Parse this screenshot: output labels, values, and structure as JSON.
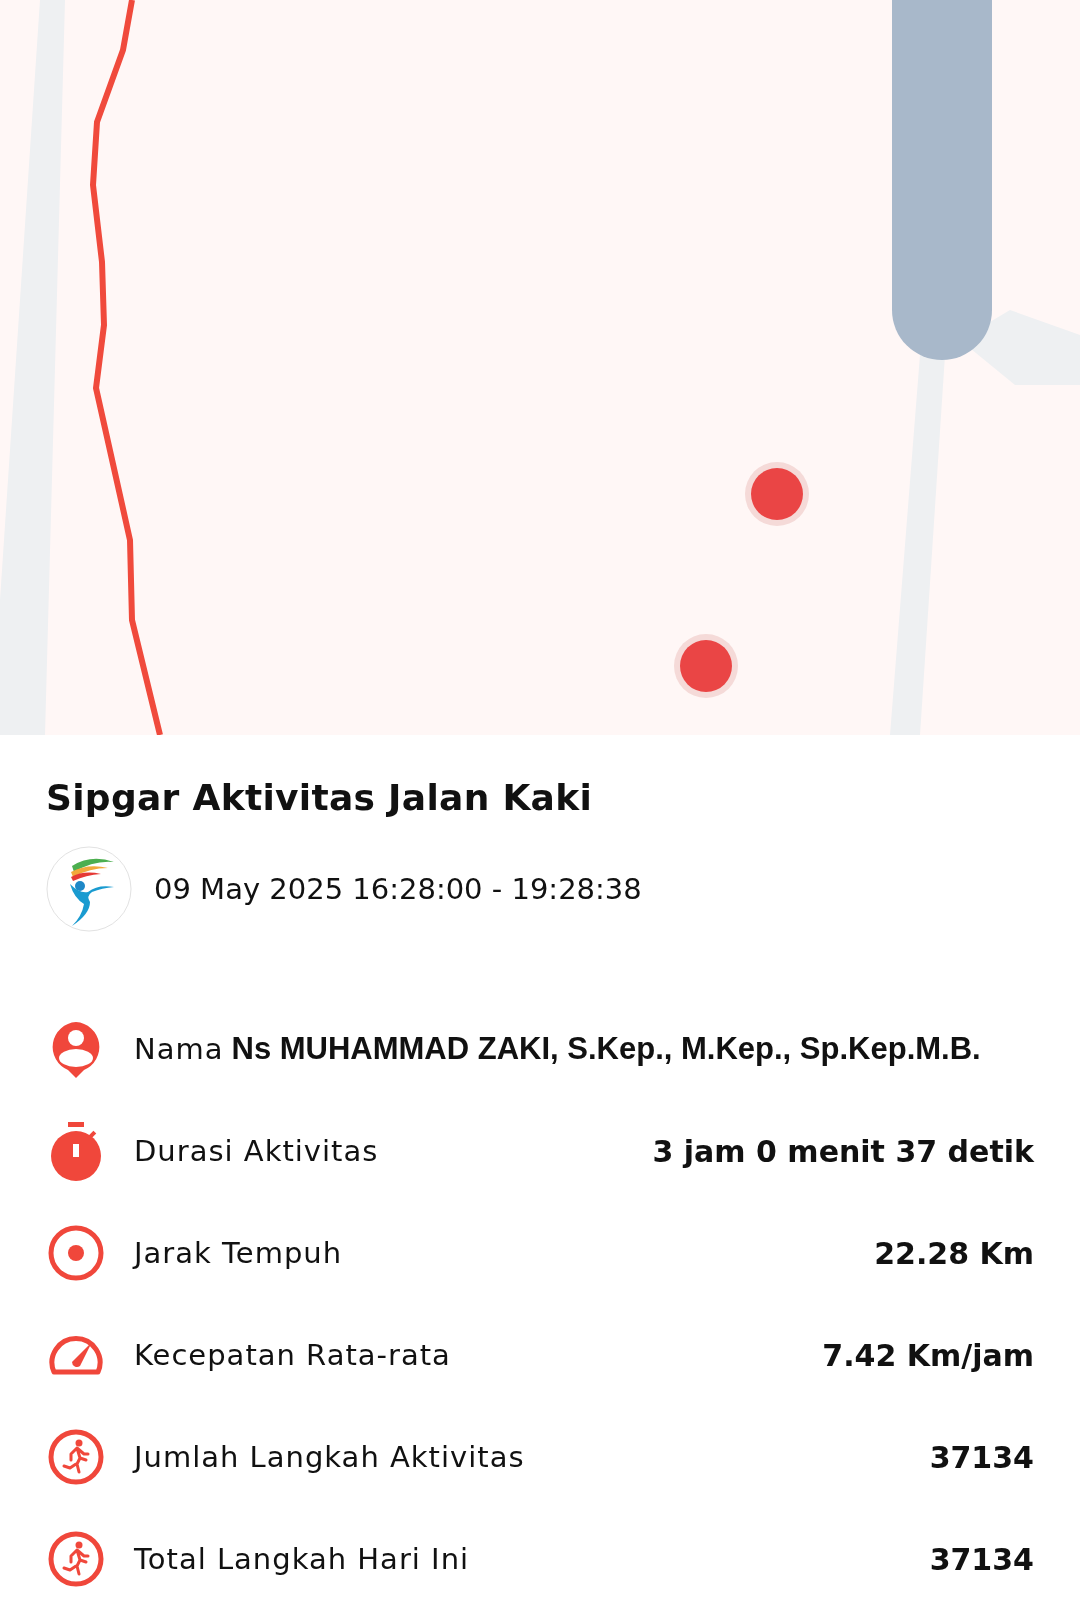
{
  "title": "Sipgar Aktivitas Jalan Kaki",
  "session": {
    "time_range": "09 May 2025 16:28:00 - 19:28:38"
  },
  "stats": [
    {
      "kind": "person",
      "label": "Nama",
      "value": "Ns MUHAMMAD ZAKI, S.Kep., M.Kep., Sp.Kep.M.B."
    },
    {
      "kind": "timer",
      "label": "Durasi Aktivitas",
      "value": "3 jam 0 menit 37 detik"
    },
    {
      "kind": "target",
      "label": "Jarak Tempuh",
      "value": "22.28 Km"
    },
    {
      "kind": "speed",
      "label": "Kecepatan Rata-rata",
      "value": "7.42 Km/jam"
    },
    {
      "kind": "run",
      "label": "Jumlah Langkah Aktivitas",
      "value": "37134"
    },
    {
      "kind": "run",
      "label": "Total Langkah Hari Ini",
      "value": "37134"
    }
  ]
}
